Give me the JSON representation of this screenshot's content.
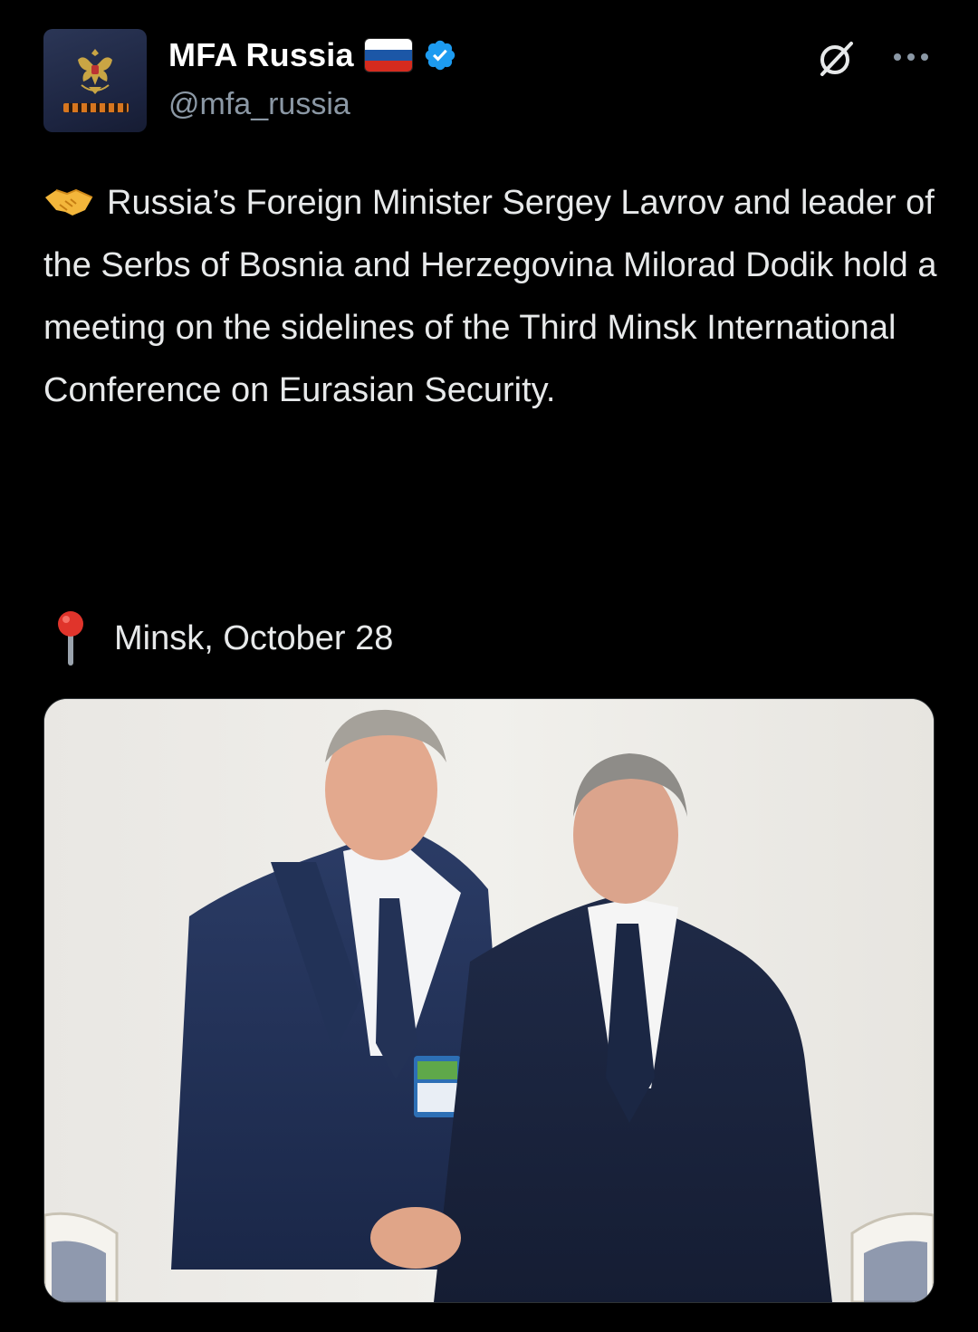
{
  "author": {
    "display_name": "MFA Russia",
    "handle": "@mfa_russia",
    "flag_colors": [
      "#ffffff",
      "#1c57a7",
      "#d52b1e"
    ],
    "verified_color": "#1d9bf0",
    "avatar_icon": "coat-of-arms-icon"
  },
  "actions": {
    "grok_icon": "grok-icon",
    "more_icon": "more-horizontal-icon"
  },
  "post": {
    "text": "Russia’s Foreign Minister Sergey Lavrov and leader of the Serbs of Bosnia and Herzegovina Milorad Dodik hold a meeting on the sidelines of the Third Minsk International Conference on Eurasian Security.",
    "leading_emoji": "handshake-icon",
    "location_emoji": "round-pushpin-icon",
    "location": "Minsk, October 28"
  },
  "media": {
    "type": "photo",
    "icon": "photo-two-men-handshake"
  },
  "colors": {
    "background": "#000000",
    "text": "#e7e9ea",
    "muted": "#8b98a5"
  }
}
